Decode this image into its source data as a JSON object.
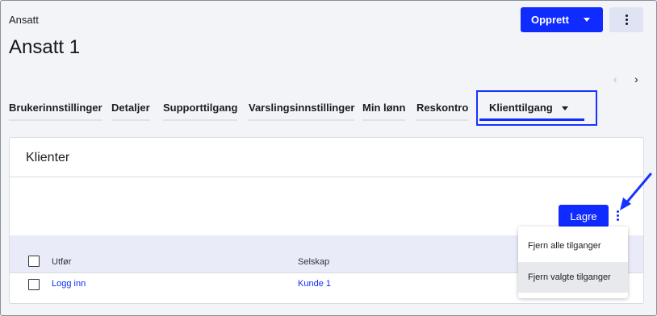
{
  "header": {
    "breadcrumb": "Ansatt",
    "title": "Ansatt 1",
    "create_button": "Opprett",
    "more_icon": "kebab-vertical-icon"
  },
  "tabs": [
    {
      "label": "Brukerinnstillinger"
    },
    {
      "label": "Detaljer"
    },
    {
      "label": "Supporttilgang"
    },
    {
      "label": "Varslingsinnstillinger"
    },
    {
      "label": "Min lønn"
    },
    {
      "label": "Reskontro"
    },
    {
      "label": "Klienttilgang",
      "active": true
    }
  ],
  "tab_nav": {
    "prev": "‹",
    "next": "›"
  },
  "card": {
    "title": "Klienter",
    "save_button": "Lagre",
    "columns": [
      "Utfør",
      "Selskap"
    ],
    "rows": [
      {
        "action": "Logg inn",
        "company": "Kunde 1"
      }
    ]
  },
  "menu": {
    "items": [
      "Fjern alle tilganger",
      "Fjern valgte tilganger"
    ]
  },
  "colors": {
    "accent": "#0f2bff",
    "highlight_border": "#1733ff"
  }
}
